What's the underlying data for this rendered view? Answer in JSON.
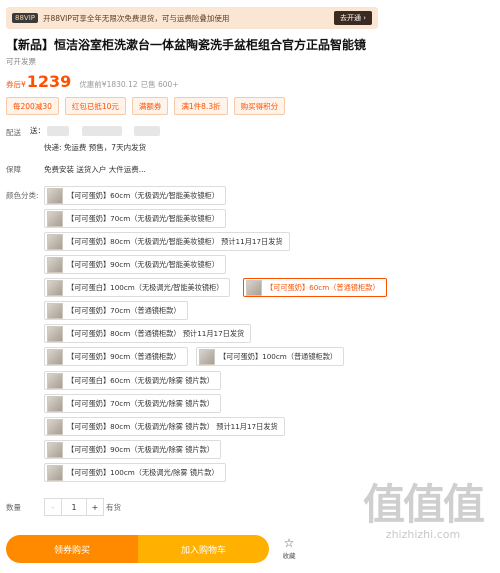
{
  "vip_bar": {
    "badge": "88VIP",
    "text": "开88VIP可享全年无限次免费退货，可与运费险叠加使用",
    "button": "去开通 ›"
  },
  "product": {
    "title": "【新品】恒洁浴室柜洗漱台一体盆陶瓷洗手盆柜组合官方正品智能镜",
    "invoice": "可开发票",
    "price_prefix": "券后¥",
    "price": "1239",
    "original_price": "优惠前¥1830.12",
    "sold": "已售 600+"
  },
  "promo_tags": [
    "每200减30",
    "红包已抵10元",
    "满额券",
    "满1件8.3折",
    "购买得积分"
  ],
  "delivery": {
    "label": "配送",
    "prefix": "送：",
    "line2": "快递: 免运费  预售，7天内发货"
  },
  "guarantee": {
    "label": "保障",
    "value": "免费安装 送货入户 大件运费..."
  },
  "options": {
    "label": "颜色分类:",
    "items": [
      {
        "label": "【可可蛋奶】60cm（无极调光/智能美妆镜柜）",
        "selected": false
      },
      {
        "label": "【可可蛋奶】70cm（无极调光/智能美妆镜柜）",
        "selected": false
      },
      {
        "label": "【可可蛋奶】80cm（无极调光/智能美妆镜柜） 预计11月17日发货",
        "selected": false
      },
      {
        "label": "【可可蛋奶】90cm（无极调光/智能美妆镜柜）",
        "selected": false
      },
      {
        "label": "【可可蛋白】100cm（无极调光/智能美妆镜柜）",
        "selected": false
      },
      {
        "label": "【可可蛋奶】60cm（普通镜柜款）",
        "selected": true
      },
      {
        "label": "【可可蛋奶】70cm（普通镜柜款）",
        "selected": false
      },
      {
        "label": "【可可蛋奶】80cm（普通镜柜款） 预计11月17日发货",
        "selected": false
      },
      {
        "label": "【可可蛋奶】90cm（普通镜柜款）",
        "selected": false
      },
      {
        "label": "【可可蛋奶】100cm（普通镜柜款）",
        "selected": false
      },
      {
        "label": "【可可蛋白】60cm（无极调光/除雾 镜片款）",
        "selected": false
      },
      {
        "label": "【可可蛋奶】70cm（无极调光/除雾 镜片款）",
        "selected": false
      },
      {
        "label": "【可可蛋奶】80cm（无极调光/除雾 镜片款） 预计11月17日发货",
        "selected": false
      },
      {
        "label": "【可可蛋奶】90cm（无极调光/除雾 镜片款）",
        "selected": false
      },
      {
        "label": "【可可蛋奶】100cm（无极调光/除雾 镜片款）",
        "selected": false
      }
    ]
  },
  "quantity": {
    "label": "数量",
    "minus": "-",
    "value": "1",
    "plus": "+",
    "stock": "有货"
  },
  "actions": {
    "buy_now": "领券购买",
    "add_to_cart": "加入购物车",
    "favorite": "收藏",
    "favorite_icon": "star-outline-icon"
  },
  "watermark": {
    "logo": "值值值",
    "url": "zhizhizhi.com"
  },
  "colors": {
    "accent": "#ff5000",
    "buy_button": "#ff8a00",
    "cart_button": "#ffb000"
  }
}
